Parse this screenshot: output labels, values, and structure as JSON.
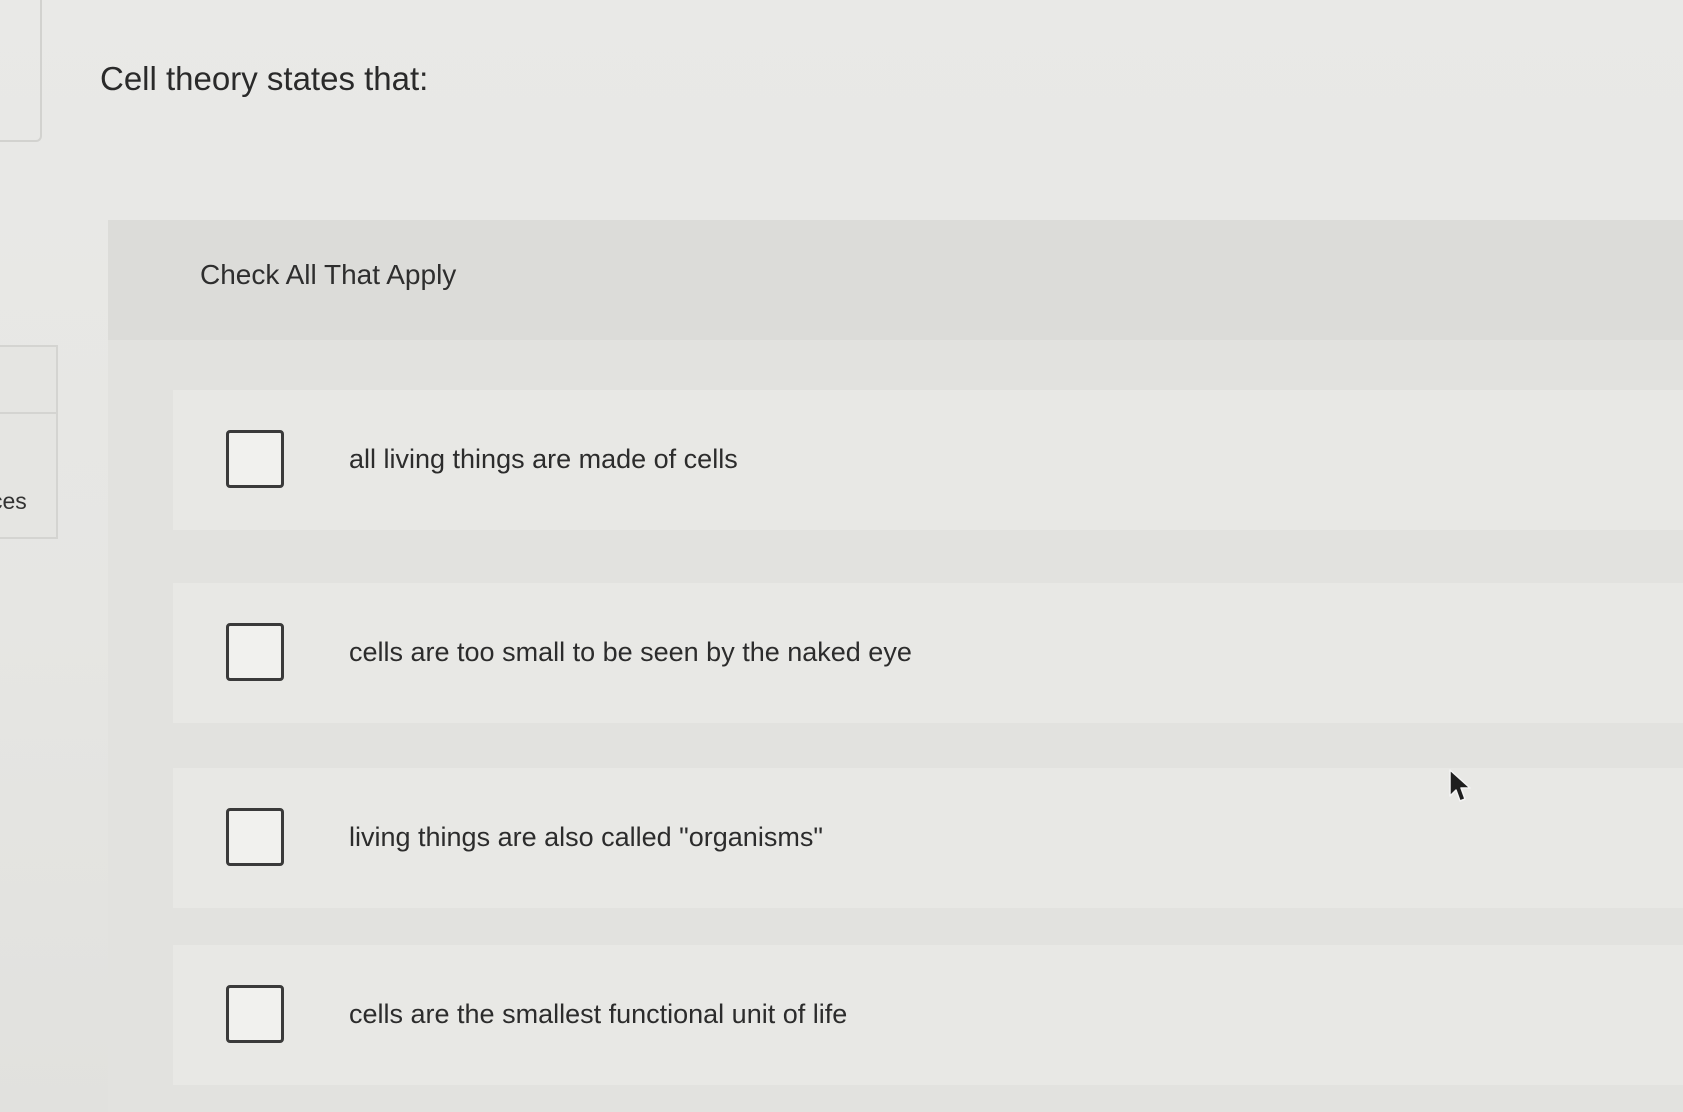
{
  "sidebar": {
    "tab_label": "ces"
  },
  "question": {
    "title": "Cell theory states that:"
  },
  "answer_panel": {
    "instruction": "Check All That Apply",
    "options": [
      {
        "label": "all living things are made of cells",
        "checked": false
      },
      {
        "label": "cells are too small to be seen by the naked eye",
        "checked": false
      },
      {
        "label": "living things are also called \"organisms\"",
        "checked": false
      },
      {
        "label": "cells are the smallest functional unit of life",
        "checked": false
      }
    ]
  },
  "icons": {
    "cursor": "mouse-pointer-icon"
  }
}
